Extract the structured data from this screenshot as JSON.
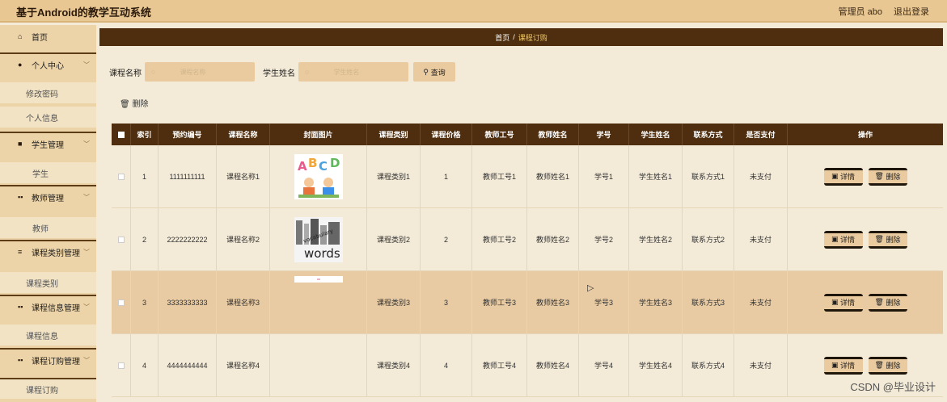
{
  "app": {
    "title": "基于Android的教学互动系统",
    "user": "管理员 abo",
    "logout": "退出登录"
  },
  "sidebar": {
    "home": "首页",
    "personal": "个人中心",
    "change_password": "修改密码",
    "personal_info": "个人信息",
    "student_mgmt": "学生管理",
    "student": "学生",
    "teacher_mgmt": "教师管理",
    "teacher": "教师",
    "course_cat_mgmt": "课程类别管理",
    "course_cat": "课程类别",
    "course_info_mgmt": "课程信息管理",
    "course_info": "课程信息",
    "course_order_mgmt": "课程订购管理",
    "course_order": "课程订购"
  },
  "breadcrumb": {
    "home": "首页",
    "sep": "/",
    "current": "课程订购"
  },
  "search": {
    "course_label": "课程名称",
    "course_placeholder": "课程名称",
    "student_label": "学生姓名",
    "student_placeholder": "学生姓名",
    "query_label": "查询"
  },
  "actions": {
    "delete": "删除"
  },
  "table": {
    "headers": [
      "索引",
      "预约编号",
      "课程名称",
      "封面图片",
      "课程类别",
      "课程价格",
      "教师工号",
      "教师姓名",
      "学号",
      "学生姓名",
      "联系方式",
      "是否支付",
      "操作"
    ],
    "rows": [
      {
        "idx": "1",
        "order_no": "1111111111",
        "course": "课程名称1",
        "category": "课程类别1",
        "price": "1",
        "teacher_no": "教师工号1",
        "teacher": "教师姓名1",
        "student_no": "学号1",
        "student": "学生姓名1",
        "contact": "联系方式1",
        "paid": "未支付",
        "img": "abcd"
      },
      {
        "idx": "2",
        "order_no": "2222222222",
        "course": "课程名称2",
        "category": "课程类别2",
        "price": "2",
        "teacher_no": "教师工号2",
        "teacher": "教师姓名2",
        "student_no": "学号2",
        "student": "学生姓名2",
        "contact": "联系方式2",
        "paid": "未支付",
        "img": "words"
      },
      {
        "idx": "3",
        "order_no": "3333333333",
        "course": "课程名称3",
        "category": "课程类别3",
        "price": "3",
        "teacher_no": "教师工号3",
        "teacher": "教师姓名3",
        "student_no": "学号3",
        "student": "学生姓名3",
        "contact": "联系方式3",
        "paid": "未支付",
        "img": "strip"
      },
      {
        "idx": "4",
        "order_no": "4444444444",
        "course": "课程名称4",
        "category": "课程类别4",
        "price": "4",
        "teacher_no": "教师工号4",
        "teacher": "教师姓名4",
        "student_no": "学号4",
        "student": "学生姓名4",
        "contact": "联系方式4",
        "paid": "未支付",
        "img": "none"
      }
    ],
    "detail_label": "详情",
    "delete_label": "删除"
  },
  "image_text": {
    "abcd": [
      "A",
      "B",
      "C",
      "D"
    ],
    "words": "words",
    "vocab": "vocabulary"
  },
  "watermark": "CSDN @毕业设计",
  "colors": {
    "brown": "#4e2e0e",
    "tan": "#e9c792",
    "sand": "#eacba0"
  }
}
